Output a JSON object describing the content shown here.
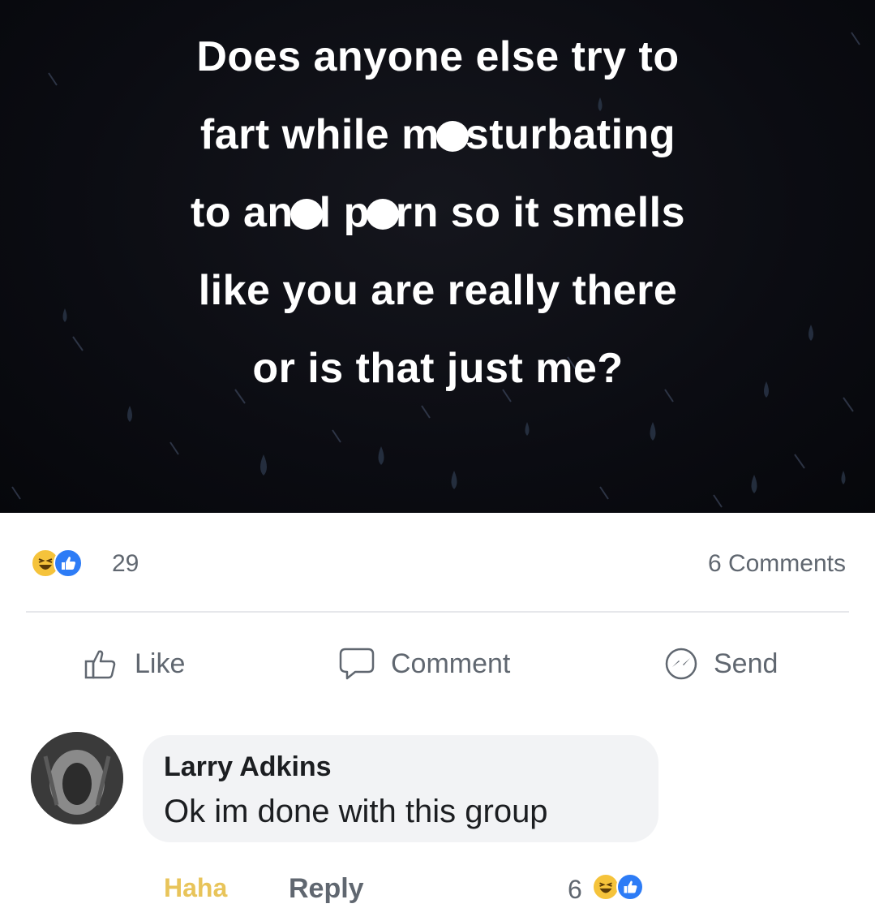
{
  "post": {
    "image_text_lines": [
      [
        "Does anyone else try to"
      ],
      [
        "fart while m",
        "sturbating"
      ],
      [
        "to an",
        "l p",
        "rn so it smells"
      ],
      [
        "like you are really there"
      ],
      [
        "or is that just me?"
      ]
    ],
    "background_color": "#0b0c12"
  },
  "reactions": {
    "icons": [
      "haha-emoji",
      "like-emoji"
    ],
    "count": "29",
    "comments_count": "6 Comments"
  },
  "actions": {
    "like_label": "Like",
    "comment_label": "Comment",
    "send_label": "Send"
  },
  "comment": {
    "author": "Larry Adkins",
    "text": "Ok im done with this group",
    "haha_label": "Haha",
    "reply_label": "Reply",
    "reaction_count": "6",
    "reaction_icons": [
      "haha-emoji",
      "like-emoji"
    ]
  },
  "colors": {
    "like_blue": "#2d7cf6",
    "haha_yellow": "#f5c33b",
    "secondary_text": "#606770",
    "bubble_bg": "#f2f3f5"
  }
}
